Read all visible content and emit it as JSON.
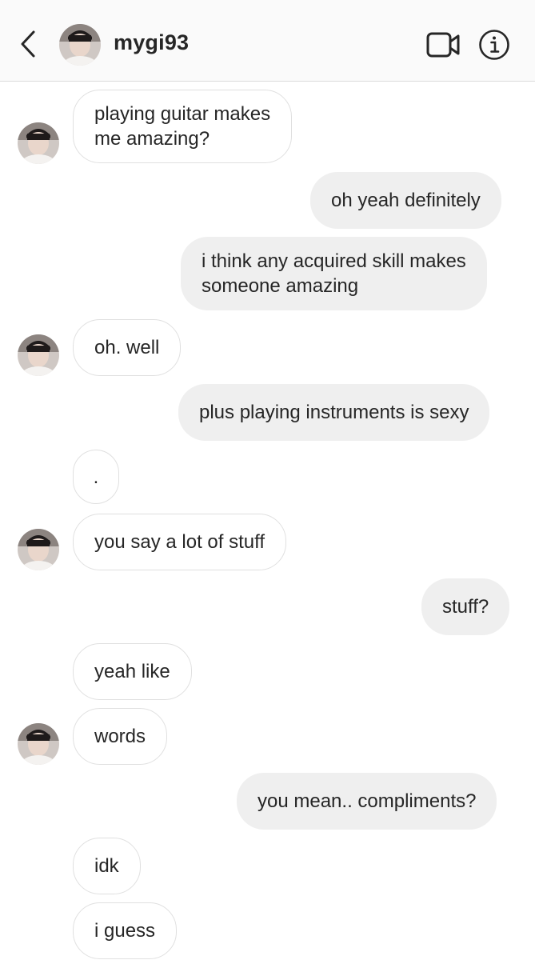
{
  "header": {
    "username": "mygi93",
    "back_icon": "chevron-left-icon",
    "video_icon": "video-camera-icon",
    "info_icon": "info-icon"
  },
  "messages": [
    {
      "from": "them",
      "text": "playing guitar makes\nme amazing?"
    },
    {
      "from": "me",
      "text": "oh yeah definitely"
    },
    {
      "from": "me",
      "text": "i think any acquired skill makes\nsomeone amazing"
    },
    {
      "from": "them",
      "text": "oh. well"
    },
    {
      "from": "me",
      "text": "plus playing instruments is sexy"
    },
    {
      "from": "them",
      "text": "."
    },
    {
      "from": "them",
      "text": "you say a lot of stuff"
    },
    {
      "from": "me",
      "text": "stuff?"
    },
    {
      "from": "them",
      "text": "yeah like"
    },
    {
      "from": "them",
      "text": "words"
    },
    {
      "from": "me",
      "text": "you mean.. compliments?"
    },
    {
      "from": "them",
      "text": "idk"
    },
    {
      "from": "them",
      "text": "i guess"
    }
  ],
  "colors": {
    "header_bg": "#fafafa",
    "incoming_bubble_bg": "#ffffff",
    "incoming_bubble_border": "#e0e0e0",
    "outgoing_bubble_bg": "#efefef",
    "text": "#262626"
  }
}
